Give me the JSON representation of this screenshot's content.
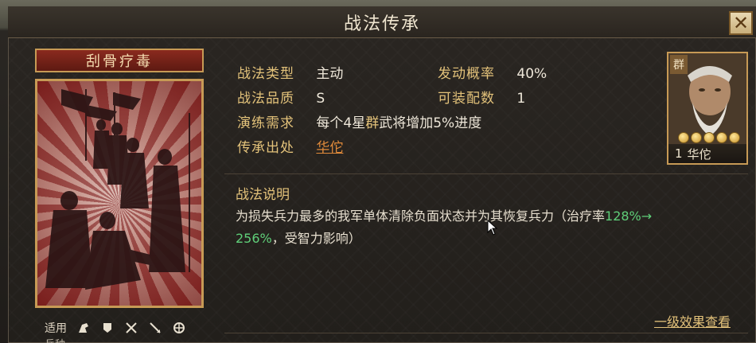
{
  "window": {
    "title": "战法传承",
    "close_label": "✕"
  },
  "skill": {
    "name": "刮骨疗毒",
    "applicable_label": "适用",
    "applicable_sub_label": "兵种",
    "troop_icons": [
      "cavalry-icon",
      "shield-icon",
      "archer-icon",
      "spear-icon",
      "siege-icon"
    ]
  },
  "info": {
    "type_label": "战法类型",
    "type_value": "主动",
    "quality_label": "战法品质",
    "quality_value": "S",
    "practice_label": "演练需求",
    "practice_value_prefix": "每个4星",
    "practice_value_highlight": "群",
    "practice_value_suffix": "武将增加5%进度",
    "source_label": "传承出处",
    "source_value": "华佗",
    "trigger_label": "发动概率",
    "trigger_value": "40%",
    "equip_label": "可装配数",
    "equip_value": "1"
  },
  "description": {
    "title": "战法说明",
    "text_prefix": "为损失兵力最多的我军单体清除负面状态并为其恢复兵力（治疗率",
    "text_green_1": "128%→",
    "text_green_2": "256%",
    "text_suffix": "，受智力影响）"
  },
  "hero": {
    "faction": "群",
    "level": "1",
    "name": "华佗",
    "stars": 5
  },
  "footer": {
    "view_link": "一级效果查看"
  }
}
